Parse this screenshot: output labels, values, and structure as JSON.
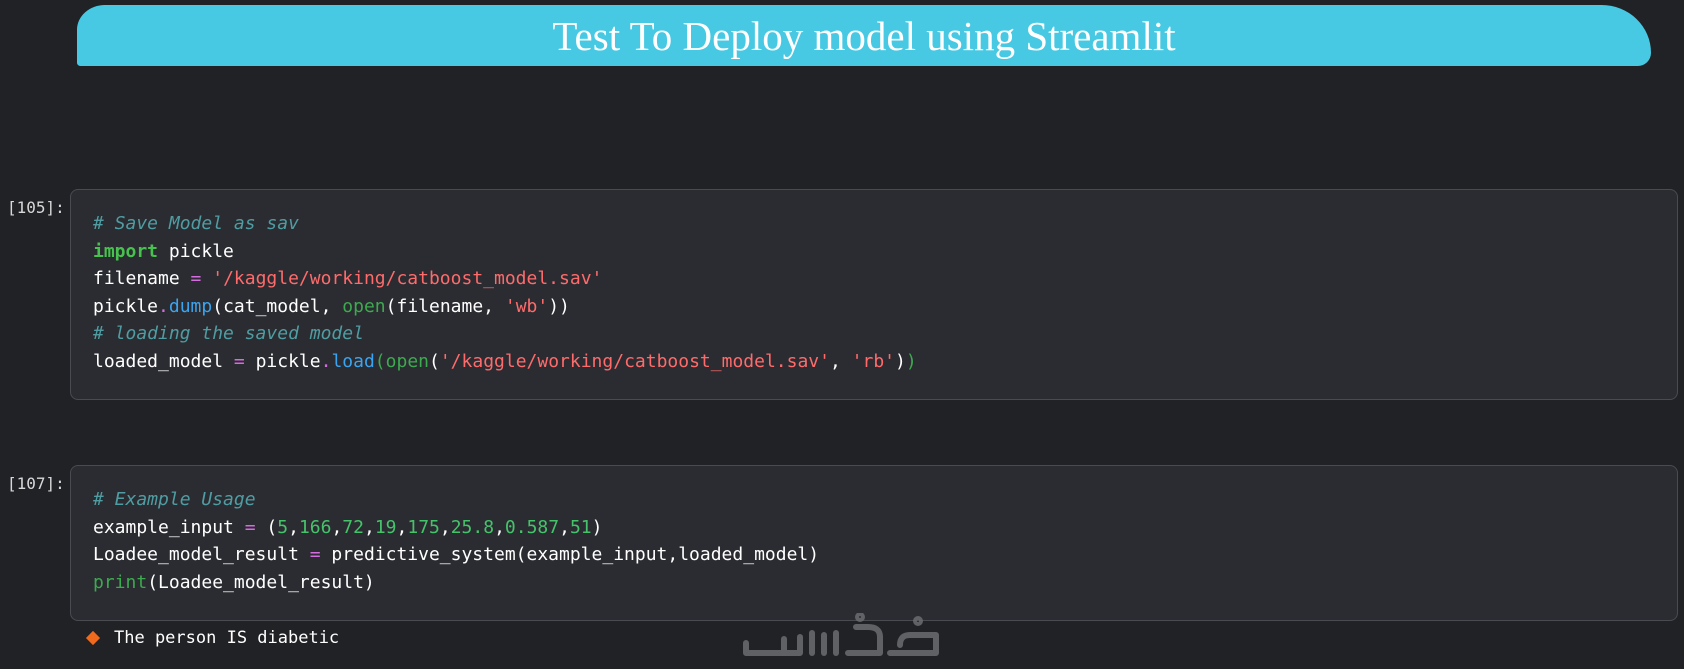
{
  "banner": {
    "title": "Test To Deploy model using Streamlit"
  },
  "cells": [
    {
      "prompt": "[105]:",
      "lines": [
        [
          {
            "t": "# Save Model as sav",
            "c": "cm"
          }
        ],
        [
          {
            "t": "import",
            "c": "kw"
          },
          {
            "t": " pickle",
            "c": "pl"
          }
        ],
        [
          {
            "t": "filename ",
            "c": "pl"
          },
          {
            "t": "=",
            "c": "op"
          },
          {
            "t": " ",
            "c": "pl"
          },
          {
            "t": "'/kaggle/working/catboost_model.sav'",
            "c": "str"
          }
        ],
        [
          {
            "t": "pickle",
            "c": "pl"
          },
          {
            "t": ".",
            "c": "op"
          },
          {
            "t": "dump",
            "c": "fn"
          },
          {
            "t": "(cat_model, ",
            "c": "pl"
          },
          {
            "t": "open",
            "c": "bi"
          },
          {
            "t": "(filename, ",
            "c": "pl"
          },
          {
            "t": "'wb'",
            "c": "str"
          },
          {
            "t": "))",
            "c": "pl"
          }
        ],
        [
          {
            "t": "# loading the saved model",
            "c": "cm"
          }
        ],
        [
          {
            "t": "loaded_model ",
            "c": "pl"
          },
          {
            "t": "=",
            "c": "op"
          },
          {
            "t": " pickle",
            "c": "pl"
          },
          {
            "t": ".",
            "c": "op"
          },
          {
            "t": "load",
            "c": "fn"
          },
          {
            "t": "(",
            "c": "bi"
          },
          {
            "t": "open",
            "c": "bi"
          },
          {
            "t": "(",
            "c": "pl"
          },
          {
            "t": "'/kaggle/working/catboost_model.sav'",
            "c": "str"
          },
          {
            "t": ", ",
            "c": "pl"
          },
          {
            "t": "'rb'",
            "c": "str"
          },
          {
            "t": ")",
            "c": "pl"
          },
          {
            "t": ")",
            "c": "bi"
          }
        ]
      ]
    },
    {
      "prompt": "[107]:",
      "lines": [
        [
          {
            "t": "# Example Usage",
            "c": "cm"
          }
        ],
        [
          {
            "t": "example_input ",
            "c": "pl"
          },
          {
            "t": "=",
            "c": "op"
          },
          {
            "t": " (",
            "c": "pl"
          },
          {
            "t": "5",
            "c": "num"
          },
          {
            "t": ",",
            "c": "pl"
          },
          {
            "t": "166",
            "c": "num"
          },
          {
            "t": ",",
            "c": "pl"
          },
          {
            "t": "72",
            "c": "num"
          },
          {
            "t": ",",
            "c": "pl"
          },
          {
            "t": "19",
            "c": "num"
          },
          {
            "t": ",",
            "c": "pl"
          },
          {
            "t": "175",
            "c": "num"
          },
          {
            "t": ",",
            "c": "pl"
          },
          {
            "t": "25.8",
            "c": "num"
          },
          {
            "t": ",",
            "c": "pl"
          },
          {
            "t": "0.587",
            "c": "num"
          },
          {
            "t": ",",
            "c": "pl"
          },
          {
            "t": "51",
            "c": "num"
          },
          {
            "t": ")",
            "c": "pl"
          }
        ],
        [
          {
            "t": "Loadee_model_result ",
            "c": "pl"
          },
          {
            "t": "=",
            "c": "op"
          },
          {
            "t": " predictive_system(example_input,loaded_model)",
            "c": "pl"
          }
        ],
        [
          {
            "t": "print",
            "c": "bi"
          },
          {
            "t": "(Loadee_model_result)",
            "c": "pl"
          }
        ]
      ],
      "output": "The person IS diabetic"
    }
  ],
  "colors": {
    "background": "#212226",
    "banner": "#48c9e3",
    "cell_bg": "#2b2c31",
    "comment": "#4f9da2",
    "keyword": "#48c24e",
    "string": "#ff6b6b",
    "function": "#3ba4f0",
    "builtin": "#3daa4f",
    "operator": "#d56de0",
    "number": "#45c36a",
    "output_marker": "#f06a1d"
  },
  "watermark": {
    "icon": "watermark-logo-icon",
    "text": "خمسات"
  }
}
